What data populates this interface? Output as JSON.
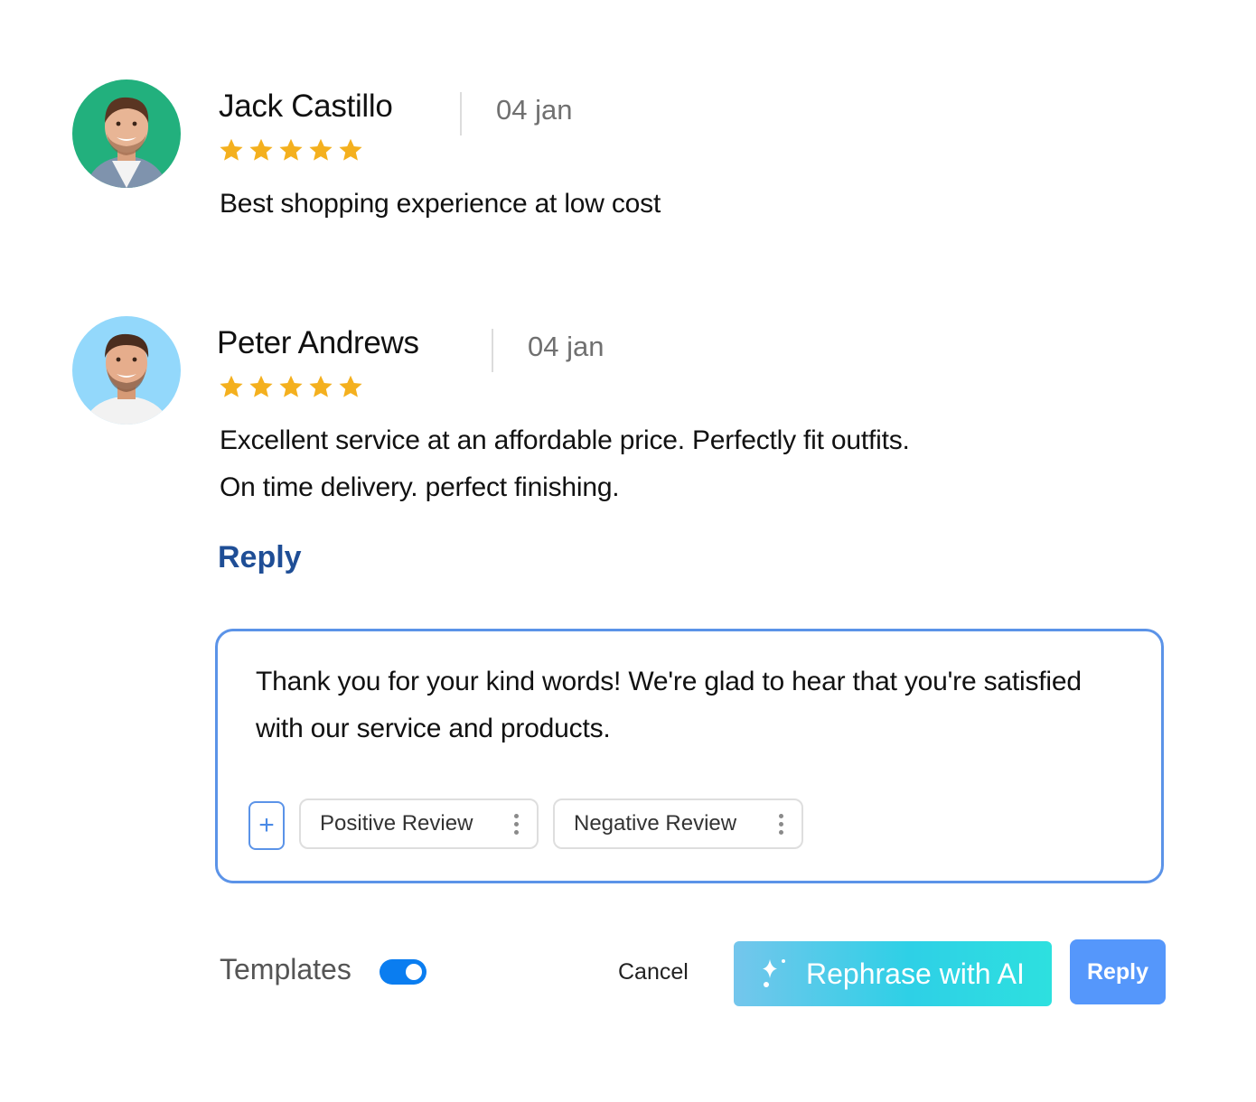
{
  "colors": {
    "star": "#f4b01e",
    "reply_link": "#1f4e96",
    "reply_box_border": "#5b93e8",
    "toggle_on": "#0a7df0",
    "reply_button": "#5597fb",
    "avatar_bg_1": "#22b07d",
    "avatar_bg_2": "#93d8fb"
  },
  "reviews": [
    {
      "name": "Jack Castillo",
      "date": "04 jan",
      "rating": 5,
      "max_rating": 5,
      "text": "Best shopping experience at low cost",
      "avatar_icon": "person-avatar"
    },
    {
      "name": "Peter Andrews",
      "date": "04 jan",
      "rating": 5,
      "max_rating": 5,
      "text": "Excellent service at an affordable price. Perfectly fit outfits. On time delivery. perfect finishing.",
      "avatar_icon": "person-avatar"
    }
  ],
  "reply_section": {
    "heading": "Reply",
    "reply_text": "Thank you for your kind words! We're glad to hear that you're satisfied with our service and products.",
    "add_template_icon": "plus-icon",
    "add_template_label": "+",
    "templates": [
      {
        "label": "Positive Review",
        "menu_icon": "kebab-menu-icon"
      },
      {
        "label": "Negative Review",
        "menu_icon": "kebab-menu-icon"
      }
    ]
  },
  "footer": {
    "templates_label": "Templates",
    "templates_enabled": true,
    "cancel_label": "Cancel",
    "ai_button_label": "Rephrase with AI",
    "ai_button_icon": "sparkle-icon",
    "reply_button_label": "Reply"
  }
}
